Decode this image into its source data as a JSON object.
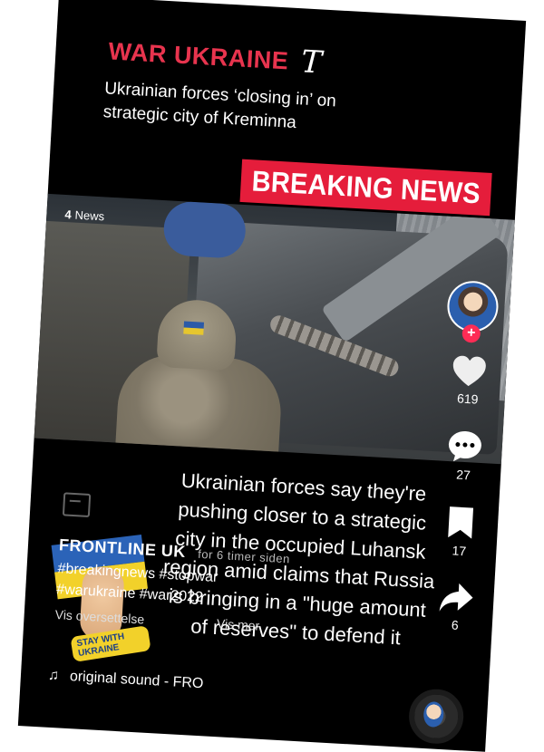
{
  "header": {
    "brand": "WAR UKRAINE",
    "brand_logo": "T",
    "headline": "Ukrainian forces ‘closing in’ on strategic city of Kreminna",
    "breaking_banner": "BREAKING NEWS"
  },
  "video": {
    "source_tag_icon": "channel-4-icon",
    "source_tag_label": "News"
  },
  "caption": "Ukrainian forces say they're pushing closer to a strategic city in the occupied Luhansk region amid claims that Russia is bringing in a \"huge amount of reserves\" to defend it",
  "post": {
    "author": "FRONTLINE UK",
    "time": "for 6 timer siden",
    "hashtags_line1": "#breakingnews #stopwar",
    "hashtags_line2": "#warukraine #war2022",
    "see_translation": "Vis oversettelse",
    "see_more": "Vis mer",
    "sound": "original sound - FRO",
    "sticker_text": "STAY WITH UKRAINE"
  },
  "actions": {
    "likes": "619",
    "comments": "27",
    "bookmarks": "17",
    "shares": "6"
  },
  "colors": {
    "brand_red": "#e8344e",
    "banner_red": "#e51d3b",
    "follow_pink": "#fe2c55",
    "background": "#000000"
  }
}
